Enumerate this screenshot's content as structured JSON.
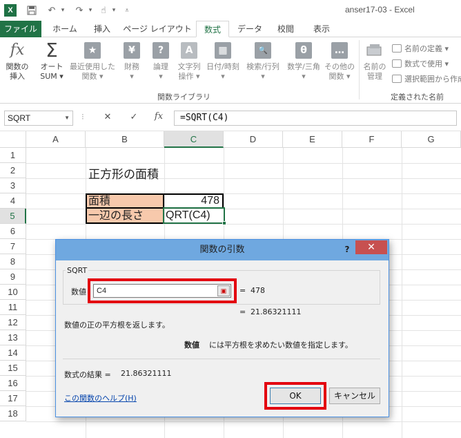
{
  "window": {
    "title": "anser17-03 - Excel",
    "app_icon": "X"
  },
  "quick_access": [
    {
      "name": "save-icon",
      "glyph": "💾"
    },
    {
      "name": "undo-icon",
      "glyph": "↶"
    },
    {
      "name": "undo-dropdown-icon",
      "glyph": "▾"
    },
    {
      "name": "redo-icon",
      "glyph": "↷"
    },
    {
      "name": "redo-dropdown-icon",
      "glyph": "▾"
    },
    {
      "name": "touch-mode-icon",
      "glyph": "☝"
    },
    {
      "name": "touch-dropdown-icon",
      "glyph": "▾"
    },
    {
      "name": "customize-qat-icon",
      "glyph": "⩡"
    }
  ],
  "tabs": [
    "ファイル",
    "ホーム",
    "挿入",
    "ページ レイアウト",
    "数式",
    "データ",
    "校閲",
    "表示"
  ],
  "active_tab": "数式",
  "ribbon": {
    "insert_function": {
      "line1": "関数の",
      "line2": "挿入",
      "icon": "fx"
    },
    "autosum": {
      "line1": "オート",
      "line2": "SUM ▾",
      "icon": "Σ"
    },
    "recent": {
      "line1": "最近使用した",
      "line2": "関数 ▾",
      "icon": "★"
    },
    "financial": {
      "line1": "財務",
      "line2": "▾",
      "icon": "¥"
    },
    "logical": {
      "line1": "論理",
      "line2": "▾",
      "icon": "?"
    },
    "text": {
      "line1": "文字列",
      "line2": "操作 ▾",
      "icon": "A"
    },
    "datetime": {
      "line1": "日付/時刻",
      "line2": "▾",
      "icon": "▦"
    },
    "lookup": {
      "line1": "検索/行列",
      "line2": "▾",
      "icon": "🔍"
    },
    "math": {
      "line1": "数学/三角",
      "line2": "▾",
      "icon": "θ"
    },
    "more": {
      "line1": "その他の",
      "line2": "関数 ▾",
      "icon": "…"
    },
    "name_manager": {
      "line1": "名前の",
      "line2": "管理"
    },
    "group_function_library": "関数ライブラリ",
    "group_defined_names": "定義された名前",
    "define_name": "名前の定義 ▾",
    "use_in_formula": "数式で使用 ▾",
    "create_from_selection": "選択範囲から作成"
  },
  "formula_bar": {
    "name_box": "SQRT",
    "cancel": "✕",
    "enter": "✓",
    "fx": "fx",
    "formula": "=SQRT(C4)"
  },
  "sheet": {
    "columns": [
      "A",
      "B",
      "C",
      "D",
      "E",
      "F",
      "G"
    ],
    "selected_column": "C",
    "rows": [
      "1",
      "2",
      "3",
      "4",
      "5",
      "6",
      "7",
      "8",
      "9",
      "10",
      "11",
      "12",
      "13",
      "14",
      "15",
      "16",
      "17",
      "18"
    ],
    "selected_row": "5",
    "title": "正方形の面積",
    "area_label": "面積",
    "area_value": "478",
    "side_label": "一辺の長さ",
    "side_formula": "QRT(C4)",
    "label_fill": "#f7c9ac"
  },
  "dialog": {
    "title": "関数の引数",
    "help_glyph": "?",
    "close_glyph": "✕",
    "function_name": "SQRT",
    "arg_label": "数値",
    "arg_value": "C4",
    "arg_equals": "=",
    "arg_result": "478",
    "result_equals": "=",
    "result_value": "21.86321111",
    "description": "数値の正の平方根を返します。",
    "arg_description_name": "数値",
    "arg_description": "には平方根を求めたい数値を指定します。",
    "formula_result_label": "数式の結果 =",
    "formula_result_value": "21.86321111",
    "help_link": "この関数のヘルプ(H)",
    "ok": "OK",
    "cancel": "キャンセル",
    "highlight_color": "#e3000f"
  }
}
